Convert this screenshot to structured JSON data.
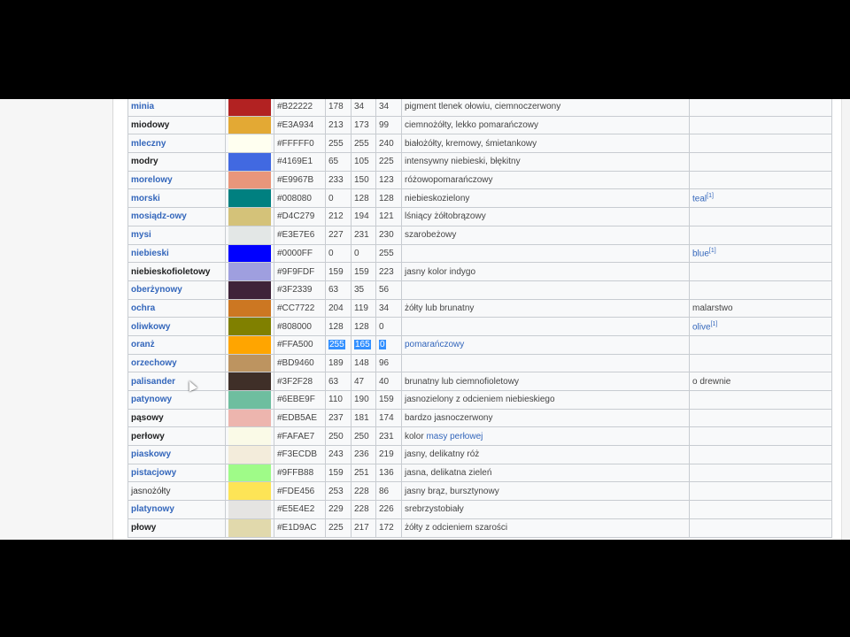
{
  "rows": [
    {
      "name": "minia",
      "style": "link",
      "color": "#B22222",
      "hex": "#B22222",
      "r": "178",
      "g": "34",
      "b": "34",
      "desc": "pigment tlenek ołowiu, ciemnoczerwony",
      "desc_link": "",
      "eng": "",
      "eng_link": false,
      "sup": ""
    },
    {
      "name": "miodowy",
      "style": "plain",
      "color": "#E3A934",
      "hex": "#E3A934",
      "r": "213",
      "g": "173",
      "b": "99",
      "desc": "ciemnożółty, lekko pomarańczowy",
      "desc_link": "",
      "eng": "",
      "eng_link": false,
      "sup": ""
    },
    {
      "name": "mleczny",
      "style": "link",
      "color": "#FFFFF0",
      "hex": "#FFFFF0",
      "r": "255",
      "g": "255",
      "b": "240",
      "desc": "białożółty, kremowy, śmietankowy",
      "desc_link": "",
      "eng": "",
      "eng_link": false,
      "sup": ""
    },
    {
      "name": "modry",
      "style": "plain",
      "color": "#4169E1",
      "hex": "#4169E1",
      "r": "65",
      "g": "105",
      "b": "225",
      "desc": "intensywny niebieski, błękitny",
      "desc_link": "",
      "eng": "",
      "eng_link": false,
      "sup": ""
    },
    {
      "name": "morelowy",
      "style": "link",
      "color": "#E9967B",
      "hex": "#E9967B",
      "r": "233",
      "g": "150",
      "b": "123",
      "desc": "różowopomarańczowy",
      "desc_link": "",
      "eng": "",
      "eng_link": false,
      "sup": ""
    },
    {
      "name": "morski",
      "style": "link",
      "color": "#008080",
      "hex": "#008080",
      "r": "0",
      "g": "128",
      "b": "128",
      "desc": "niebieskozielony",
      "desc_link": "",
      "eng": "teal",
      "eng_link": true,
      "sup": "[1]"
    },
    {
      "name": "mosiądz-owy",
      "style": "link",
      "color": "#D4C279",
      "hex": "#D4C279",
      "r": "212",
      "g": "194",
      "b": "121",
      "desc": "lśniący żółtobrązowy",
      "desc_link": "",
      "eng": "",
      "eng_link": false,
      "sup": ""
    },
    {
      "name": "mysi",
      "style": "link",
      "color": "#E3E7E6",
      "hex": "#E3E7E6",
      "r": "227",
      "g": "231",
      "b": "230",
      "desc": "szarobeżowy",
      "desc_link": "",
      "eng": "",
      "eng_link": false,
      "sup": ""
    },
    {
      "name": "niebieski",
      "style": "link",
      "color": "#0000FF",
      "hex": "#0000FF",
      "r": "0",
      "g": "0",
      "b": "255",
      "desc": "",
      "desc_link": "",
      "eng": "blue",
      "eng_link": true,
      "sup": "[1]"
    },
    {
      "name": "niebieskofioletowy",
      "style": "plain",
      "color": "#9F9FDF",
      "hex": "#9F9FDF",
      "r": "159",
      "g": "159",
      "b": "223",
      "desc": "jasny kolor indygo",
      "desc_link": "",
      "eng": "",
      "eng_link": false,
      "sup": ""
    },
    {
      "name": "oberżynowy",
      "style": "link",
      "color": "#3F2339",
      "hex": "#3F2339",
      "r": "63",
      "g": "35",
      "b": "56",
      "desc": "",
      "desc_link": "",
      "eng": "",
      "eng_link": false,
      "sup": ""
    },
    {
      "name": "ochra",
      "style": "link",
      "color": "#CC7722",
      "hex": "#CC7722",
      "r": "204",
      "g": "119",
      "b": "34",
      "desc": "żółty lub brunatny",
      "desc_link": "",
      "eng": "malarstwo",
      "eng_link": false,
      "sup": ""
    },
    {
      "name": "oliwkowy",
      "style": "link",
      "color": "#808000",
      "hex": "#808000",
      "r": "128",
      "g": "128",
      "b": "0",
      "desc": "",
      "desc_link": "",
      "eng": "olive",
      "eng_link": true,
      "sup": "[1]"
    },
    {
      "name": "oranż",
      "style": "link",
      "color": "#FFA500",
      "hex": "#FFA500",
      "r": "255",
      "g": "165",
      "b": "0",
      "desc": "pomarańczowy",
      "desc_link": "",
      "eng": "",
      "eng_link": false,
      "sup": "",
      "selected": true
    },
    {
      "name": "orzechowy",
      "style": "link",
      "color": "#BD9460",
      "hex": "#BD9460",
      "r": "189",
      "g": "148",
      "b": "96",
      "desc": "",
      "desc_link": "",
      "eng": "",
      "eng_link": false,
      "sup": ""
    },
    {
      "name": "palisander",
      "style": "link",
      "color": "#3F2F28",
      "hex": "#3F2F28",
      "r": "63",
      "g": "47",
      "b": "40",
      "desc": "brunatny lub ciemnofioletowy",
      "desc_link": "",
      "eng": "o drewnie",
      "eng_link": false,
      "sup": ""
    },
    {
      "name": "patynowy",
      "style": "link",
      "color": "#6EBE9F",
      "hex": "#6EBE9F",
      "r": "110",
      "g": "190",
      "b": "159",
      "desc": "jasnozielony z odcieniem niebieskiego",
      "desc_link": "",
      "eng": "",
      "eng_link": false,
      "sup": ""
    },
    {
      "name": "pąsowy",
      "style": "plain",
      "color": "#EDB5AE",
      "hex": "#EDB5AE",
      "r": "237",
      "g": "181",
      "b": "174",
      "desc": "bardzo jasnoczerwony",
      "desc_link": "",
      "eng": "",
      "eng_link": false,
      "sup": ""
    },
    {
      "name": "perłowy",
      "style": "plain",
      "color": "#FAFAE7",
      "hex": "#FAFAE7",
      "r": "250",
      "g": "250",
      "b": "231",
      "desc": "kolor ",
      "desc_link": "masy perłowej",
      "eng": "",
      "eng_link": false,
      "sup": ""
    },
    {
      "name": "piaskowy",
      "style": "link",
      "color": "#F3ECDB",
      "hex": "#F3ECDB",
      "r": "243",
      "g": "236",
      "b": "219",
      "desc": "jasny, delikatny róż",
      "desc_link": "",
      "eng": "",
      "eng_link": false,
      "sup": ""
    },
    {
      "name": "pistacjowy",
      "style": "link",
      "color": "#9FFB88",
      "hex": "#9FFB88",
      "r": "159",
      "g": "251",
      "b": "136",
      "desc": "jasna, delikatna zieleń",
      "desc_link": "",
      "eng": "",
      "eng_link": false,
      "sup": ""
    },
    {
      "name": "jasnożółty",
      "style": "normal",
      "color": "#FDE456",
      "hex": "#FDE456",
      "r": "253",
      "g": "228",
      "b": "86",
      "desc": "jasny brąz, bursztynowy",
      "desc_link": "",
      "eng": "",
      "eng_link": false,
      "sup": ""
    },
    {
      "name": "platynowy",
      "style": "link",
      "color": "#E5E4E2",
      "hex": "#E5E4E2",
      "r": "229",
      "g": "228",
      "b": "226",
      "desc": "srebrzystobiały",
      "desc_link": "",
      "eng": "",
      "eng_link": false,
      "sup": ""
    },
    {
      "name": "płowy",
      "style": "plain",
      "color": "#E1D9AC",
      "hex": "#E1D9AC",
      "r": "225",
      "g": "217",
      "b": "172",
      "desc": "żółty z odcieniem szarości",
      "desc_link": "",
      "eng": "",
      "eng_link": false,
      "sup": ""
    }
  ]
}
